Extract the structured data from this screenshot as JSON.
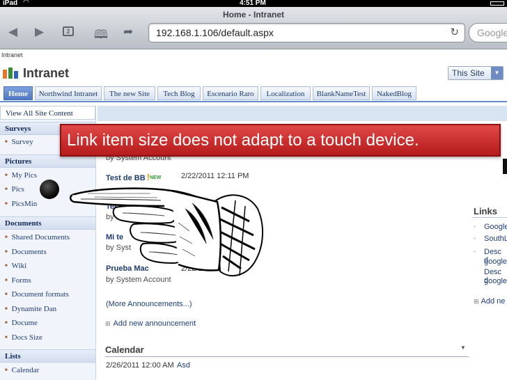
{
  "status_bar": {
    "device": "iPad",
    "time": "4:51 PM"
  },
  "browser": {
    "page_title": "Home - Intranet",
    "url": "192.168.1.106/default.aspx",
    "search_placeholder": "Google"
  },
  "site": {
    "breadcrumb": "Intranet",
    "name": "Intranet",
    "scope_selector": "This Site"
  },
  "top_nav": [
    "Home",
    "Northwind Intranet",
    "The new Site",
    "Tech Blog",
    "Escenario Raro",
    "Localization",
    "BlankNameTest",
    "NakedBlog"
  ],
  "left_nav": {
    "view_all": "View All Site Content",
    "surveys": {
      "heading": "Surveys",
      "items": [
        "Survey"
      ]
    },
    "pictures": {
      "heading": "Pictures",
      "items": [
        "My Pics",
        "Pics",
        "PicsMin"
      ]
    },
    "documents": {
      "heading": "Documents",
      "items": [
        "Shared Documents",
        "Documents",
        "Wiki",
        "Forms",
        "Document formats",
        "Dynamite Dan",
        "Docume",
        "Docs Size"
      ]
    },
    "lists": {
      "heading": "Lists",
      "items": [
        "Calendar"
      ]
    }
  },
  "announcements": {
    "items": [
      {
        "title": "Test de BB",
        "badge": "NEW",
        "date": "2/22/2011 12:11 PM"
      },
      {
        "title": "Test",
        "date": "AM",
        "by": "by S"
      },
      {
        "title": "Mi te",
        "by": "by Syst"
      },
      {
        "title": "Prueba Mac",
        "date": "2/22/201",
        "by": "by System Account"
      }
    ],
    "partial_by": "by System Account",
    "more_link": "(More Announcements...)",
    "add_new": "Add new announcement"
  },
  "links": {
    "heading": "Links",
    "items": [
      "Google",
      "SouthL",
      "Desc d",
      "google",
      "Desc d",
      "google"
    ],
    "add_new": "Add ne"
  },
  "calendar": {
    "heading": "Calendar",
    "first_event_date": "2/26/2011 12:00 AM",
    "first_event_title": "Asd"
  },
  "overlay": {
    "banner_text": "Link item size does not adapt to a touch device."
  },
  "colors": {
    "banner": "#c42828",
    "nav_active": "#5a80c8",
    "nav_text": "#1f3c79"
  }
}
